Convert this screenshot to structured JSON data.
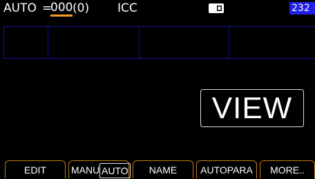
{
  "status": {
    "mode_label": "AUTO",
    "equals": "=",
    "mode_value": "000",
    "mode_count": "(0)",
    "icc_label": "ICC",
    "port_badge": "232"
  },
  "main": {
    "view_label": "VIEW"
  },
  "softkeys": {
    "edit": "EDIT",
    "manu": "MANU",
    "auto": "AUTO",
    "name": "NAME",
    "autopara": "AUTOPARA",
    "more": "MORE.."
  },
  "colors": {
    "accent": "#f0a020",
    "grid": "#1212b0",
    "badge": "#1f1fe8",
    "softkey_border": "#c47a1c"
  },
  "icons": {
    "memory": "memory-card-icon"
  }
}
